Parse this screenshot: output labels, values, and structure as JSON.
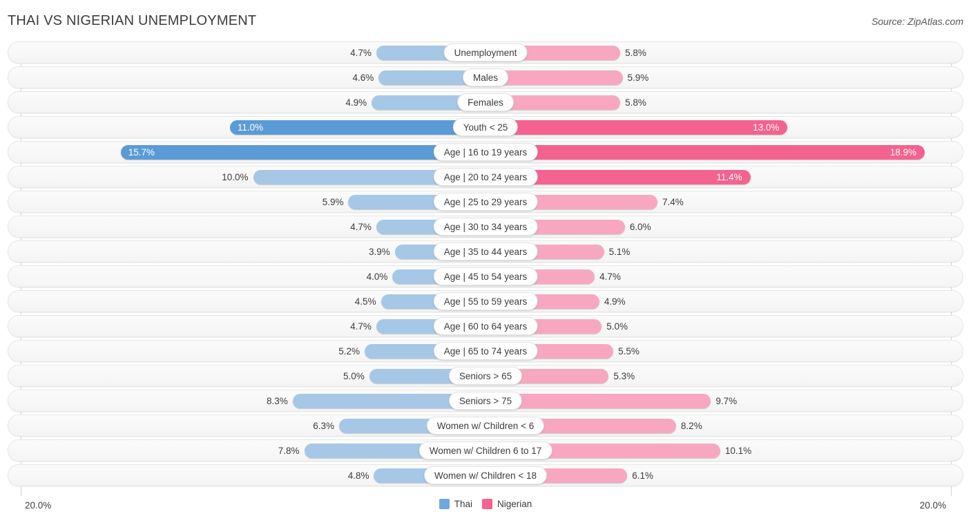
{
  "header": {
    "title": "THAI VS NIGERIAN UNEMPLOYMENT",
    "source": "Source: ZipAtlas.com"
  },
  "axis": {
    "left_label": "20.0%",
    "right_label": "20.0%",
    "max": 20.0
  },
  "legend": {
    "items": [
      {
        "label": "Thai",
        "color": "#6fa8dc"
      },
      {
        "label": "Nigerian",
        "color": "#f4628f"
      }
    ]
  },
  "colors": {
    "thai_light": "#a7c7e7",
    "thai_dark": "#5b9bd5",
    "nigerian_light": "#f7a8c0",
    "nigerian_dark": "#f4628f",
    "track": "#f4f4f4",
    "text": "#3c3c3c"
  },
  "chart_data": {
    "type": "bar",
    "title": "THAI VS NIGERIAN UNEMPLOYMENT",
    "subtitle": "",
    "xlabel": "",
    "ylabel": "",
    "orientation": "horizontal-diverging",
    "xlim": [
      0,
      20.0
    ],
    "grid": false,
    "legend_position": "bottom-center",
    "categories": [
      "Unemployment",
      "Males",
      "Females",
      "Youth < 25",
      "Age | 16 to 19 years",
      "Age | 20 to 24 years",
      "Age | 25 to 29 years",
      "Age | 30 to 34 years",
      "Age | 35 to 44 years",
      "Age | 45 to 54 years",
      "Age | 55 to 59 years",
      "Age | 60 to 64 years",
      "Age | 65 to 74 years",
      "Seniors > 65",
      "Seniors > 75",
      "Women w/ Children < 6",
      "Women w/ Children 6 to 17",
      "Women w/ Children < 18"
    ],
    "series": [
      {
        "name": "Thai",
        "values": [
          4.7,
          4.6,
          4.9,
          11.0,
          15.7,
          10.0,
          5.9,
          4.7,
          3.9,
          4.0,
          4.5,
          4.7,
          5.2,
          5.0,
          8.3,
          6.3,
          7.8,
          4.8
        ]
      },
      {
        "name": "Nigerian",
        "values": [
          5.8,
          5.9,
          5.8,
          13.0,
          18.9,
          11.4,
          7.4,
          6.0,
          5.1,
          4.7,
          4.9,
          5.0,
          5.5,
          5.3,
          9.7,
          8.2,
          10.1,
          6.1
        ]
      }
    ]
  },
  "rows": [
    {
      "label": "Unemployment",
      "left_value": "4.7%",
      "right_value": "5.8%",
      "left_num": 4.7,
      "right_num": 5.8
    },
    {
      "label": "Males",
      "left_value": "4.6%",
      "right_value": "5.9%",
      "left_num": 4.6,
      "right_num": 5.9
    },
    {
      "label": "Females",
      "left_value": "4.9%",
      "right_value": "5.8%",
      "left_num": 4.9,
      "right_num": 5.8
    },
    {
      "label": "Youth < 25",
      "left_value": "11.0%",
      "right_value": "13.0%",
      "left_num": 11.0,
      "right_num": 13.0
    },
    {
      "label": "Age | 16 to 19 years",
      "left_value": "15.7%",
      "right_value": "18.9%",
      "left_num": 15.7,
      "right_num": 18.9
    },
    {
      "label": "Age | 20 to 24 years",
      "left_value": "10.0%",
      "right_value": "11.4%",
      "left_num": 10.0,
      "right_num": 11.4
    },
    {
      "label": "Age | 25 to 29 years",
      "left_value": "5.9%",
      "right_value": "7.4%",
      "left_num": 5.9,
      "right_num": 7.4
    },
    {
      "label": "Age | 30 to 34 years",
      "left_value": "4.7%",
      "right_value": "6.0%",
      "left_num": 4.7,
      "right_num": 6.0
    },
    {
      "label": "Age | 35 to 44 years",
      "left_value": "3.9%",
      "right_value": "5.1%",
      "left_num": 3.9,
      "right_num": 5.1
    },
    {
      "label": "Age | 45 to 54 years",
      "left_value": "4.0%",
      "right_value": "4.7%",
      "left_num": 4.0,
      "right_num": 4.7
    },
    {
      "label": "Age | 55 to 59 years",
      "left_value": "4.5%",
      "right_value": "4.9%",
      "left_num": 4.5,
      "right_num": 4.9
    },
    {
      "label": "Age | 60 to 64 years",
      "left_value": "4.7%",
      "right_value": "5.0%",
      "left_num": 4.7,
      "right_num": 5.0
    },
    {
      "label": "Age | 65 to 74 years",
      "left_value": "5.2%",
      "right_value": "5.5%",
      "left_num": 5.2,
      "right_num": 5.5
    },
    {
      "label": "Seniors > 65",
      "left_value": "5.0%",
      "right_value": "5.3%",
      "left_num": 5.0,
      "right_num": 5.3
    },
    {
      "label": "Seniors > 75",
      "left_value": "8.3%",
      "right_value": "9.7%",
      "left_num": 8.3,
      "right_num": 9.7
    },
    {
      "label": "Women w/ Children < 6",
      "left_value": "6.3%",
      "right_value": "8.2%",
      "left_num": 6.3,
      "right_num": 8.2
    },
    {
      "label": "Women w/ Children 6 to 17",
      "left_value": "7.8%",
      "right_value": "10.1%",
      "left_num": 7.8,
      "right_num": 10.1
    },
    {
      "label": "Women w/ Children < 18",
      "left_value": "4.8%",
      "right_value": "6.1%",
      "left_num": 4.8,
      "right_num": 6.1
    }
  ]
}
